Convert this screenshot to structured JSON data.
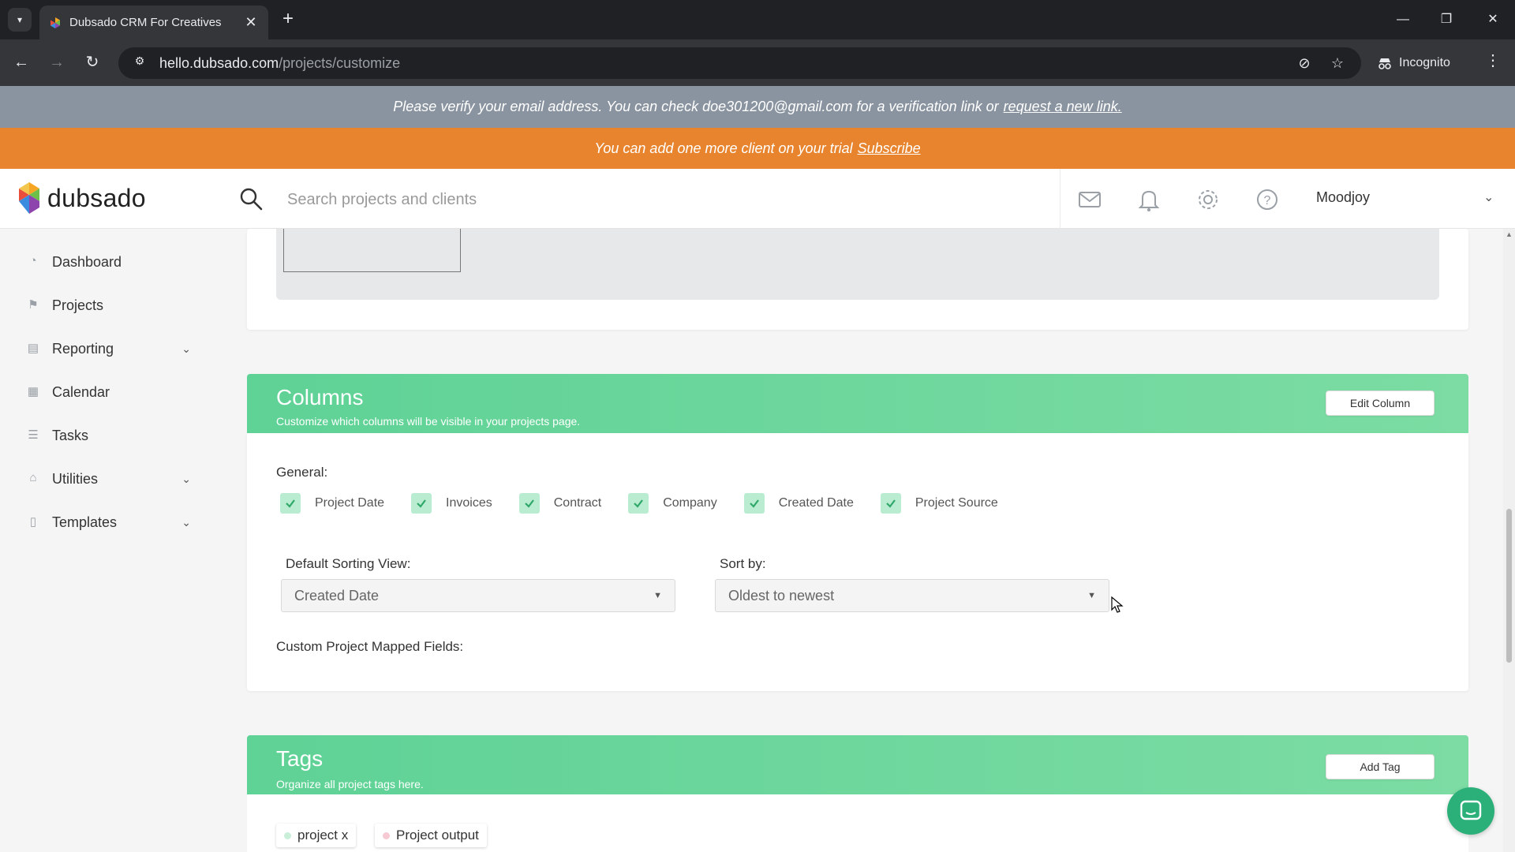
{
  "browser": {
    "tab_title": "Dubsado CRM For Creatives",
    "tab_close": "✕",
    "new_tab": "+",
    "url_host": "hello.dubsado.com",
    "url_path": "/projects/customize",
    "incognito_label": "Incognito",
    "window_controls": {
      "minimize": "—",
      "restore": "❐",
      "close": "✕"
    }
  },
  "banners": {
    "verify_text": "Please verify your email address. You can check doe301200@gmail.com for a verification link or",
    "verify_link": "request a new link.",
    "trial_text": "You can add one more client on your trial",
    "trial_link": "Subscribe"
  },
  "header": {
    "logo_text": "dubsado",
    "search_placeholder": "Search projects and clients",
    "user_name": "Moodjoy",
    "icons": [
      "mail-icon",
      "bell-icon",
      "gear-icon",
      "help-icon"
    ]
  },
  "sidebar": {
    "items": [
      {
        "label": "Dashboard",
        "icon": "dashboard-icon",
        "expandable": false
      },
      {
        "label": "Projects",
        "icon": "projects-icon",
        "expandable": false
      },
      {
        "label": "Reporting",
        "icon": "reporting-icon",
        "expandable": true
      },
      {
        "label": "Calendar",
        "icon": "calendar-icon",
        "expandable": false
      },
      {
        "label": "Tasks",
        "icon": "tasks-icon",
        "expandable": false
      },
      {
        "label": "Utilities",
        "icon": "utilities-icon",
        "expandable": true
      },
      {
        "label": "Templates",
        "icon": "templates-icon",
        "expandable": true
      }
    ]
  },
  "columns_section": {
    "title": "Columns",
    "subtitle": "Customize which columns will be visible in your projects page.",
    "edit_button": "Edit Column",
    "general_label": "General:",
    "checkboxes": [
      {
        "label": "Project Date",
        "checked": true
      },
      {
        "label": "Invoices",
        "checked": true
      },
      {
        "label": "Contract",
        "checked": true
      },
      {
        "label": "Company",
        "checked": true
      },
      {
        "label": "Created Date",
        "checked": true
      },
      {
        "label": "Project Source",
        "checked": true
      }
    ],
    "default_sorting_label": "Default Sorting View:",
    "default_sorting_value": "Created Date",
    "sort_by_label": "Sort by:",
    "sort_by_value": "Oldest to newest",
    "custom_fields_label": "Custom Project Mapped Fields:"
  },
  "tags_section": {
    "title": "Tags",
    "subtitle": "Organize all project tags here.",
    "add_button": "Add Tag",
    "tags": [
      {
        "label": "project x",
        "color": "#c9efd9"
      },
      {
        "label": "Project output",
        "color": "#f7c9d3"
      }
    ]
  },
  "colors": {
    "accent_green": "#5fd296",
    "trial_orange": "#e8842d",
    "verify_gray": "#8a94a0"
  }
}
